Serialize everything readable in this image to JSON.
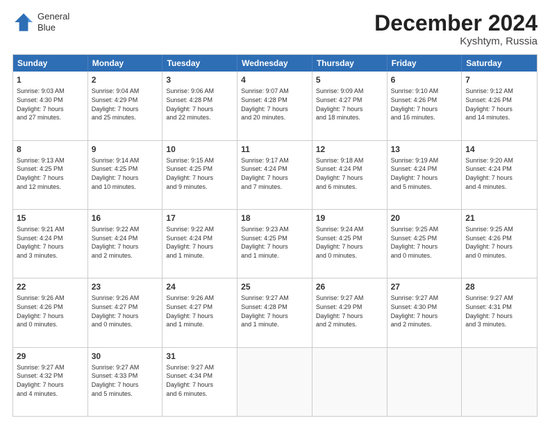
{
  "header": {
    "logo_line1": "General",
    "logo_line2": "Blue",
    "month_title": "December 2024",
    "location": "Kyshtym, Russia"
  },
  "days_of_week": [
    "Sunday",
    "Monday",
    "Tuesday",
    "Wednesday",
    "Thursday",
    "Friday",
    "Saturday"
  ],
  "weeks": [
    [
      {
        "day": "1",
        "lines": [
          "Sunrise: 9:03 AM",
          "Sunset: 4:30 PM",
          "Daylight: 7 hours",
          "and 27 minutes."
        ]
      },
      {
        "day": "2",
        "lines": [
          "Sunrise: 9:04 AM",
          "Sunset: 4:29 PM",
          "Daylight: 7 hours",
          "and 25 minutes."
        ]
      },
      {
        "day": "3",
        "lines": [
          "Sunrise: 9:06 AM",
          "Sunset: 4:28 PM",
          "Daylight: 7 hours",
          "and 22 minutes."
        ]
      },
      {
        "day": "4",
        "lines": [
          "Sunrise: 9:07 AM",
          "Sunset: 4:28 PM",
          "Daylight: 7 hours",
          "and 20 minutes."
        ]
      },
      {
        "day": "5",
        "lines": [
          "Sunrise: 9:09 AM",
          "Sunset: 4:27 PM",
          "Daylight: 7 hours",
          "and 18 minutes."
        ]
      },
      {
        "day": "6",
        "lines": [
          "Sunrise: 9:10 AM",
          "Sunset: 4:26 PM",
          "Daylight: 7 hours",
          "and 16 minutes."
        ]
      },
      {
        "day": "7",
        "lines": [
          "Sunrise: 9:12 AM",
          "Sunset: 4:26 PM",
          "Daylight: 7 hours",
          "and 14 minutes."
        ]
      }
    ],
    [
      {
        "day": "8",
        "lines": [
          "Sunrise: 9:13 AM",
          "Sunset: 4:25 PM",
          "Daylight: 7 hours",
          "and 12 minutes."
        ]
      },
      {
        "day": "9",
        "lines": [
          "Sunrise: 9:14 AM",
          "Sunset: 4:25 PM",
          "Daylight: 7 hours",
          "and 10 minutes."
        ]
      },
      {
        "day": "10",
        "lines": [
          "Sunrise: 9:15 AM",
          "Sunset: 4:25 PM",
          "Daylight: 7 hours",
          "and 9 minutes."
        ]
      },
      {
        "day": "11",
        "lines": [
          "Sunrise: 9:17 AM",
          "Sunset: 4:24 PM",
          "Daylight: 7 hours",
          "and 7 minutes."
        ]
      },
      {
        "day": "12",
        "lines": [
          "Sunrise: 9:18 AM",
          "Sunset: 4:24 PM",
          "Daylight: 7 hours",
          "and 6 minutes."
        ]
      },
      {
        "day": "13",
        "lines": [
          "Sunrise: 9:19 AM",
          "Sunset: 4:24 PM",
          "Daylight: 7 hours",
          "and 5 minutes."
        ]
      },
      {
        "day": "14",
        "lines": [
          "Sunrise: 9:20 AM",
          "Sunset: 4:24 PM",
          "Daylight: 7 hours",
          "and 4 minutes."
        ]
      }
    ],
    [
      {
        "day": "15",
        "lines": [
          "Sunrise: 9:21 AM",
          "Sunset: 4:24 PM",
          "Daylight: 7 hours",
          "and 3 minutes."
        ]
      },
      {
        "day": "16",
        "lines": [
          "Sunrise: 9:22 AM",
          "Sunset: 4:24 PM",
          "Daylight: 7 hours",
          "and 2 minutes."
        ]
      },
      {
        "day": "17",
        "lines": [
          "Sunrise: 9:22 AM",
          "Sunset: 4:24 PM",
          "Daylight: 7 hours",
          "and 1 minute."
        ]
      },
      {
        "day": "18",
        "lines": [
          "Sunrise: 9:23 AM",
          "Sunset: 4:25 PM",
          "Daylight: 7 hours",
          "and 1 minute."
        ]
      },
      {
        "day": "19",
        "lines": [
          "Sunrise: 9:24 AM",
          "Sunset: 4:25 PM",
          "Daylight: 7 hours",
          "and 0 minutes."
        ]
      },
      {
        "day": "20",
        "lines": [
          "Sunrise: 9:25 AM",
          "Sunset: 4:25 PM",
          "Daylight: 7 hours",
          "and 0 minutes."
        ]
      },
      {
        "day": "21",
        "lines": [
          "Sunrise: 9:25 AM",
          "Sunset: 4:26 PM",
          "Daylight: 7 hours",
          "and 0 minutes."
        ]
      }
    ],
    [
      {
        "day": "22",
        "lines": [
          "Sunrise: 9:26 AM",
          "Sunset: 4:26 PM",
          "Daylight: 7 hours",
          "and 0 minutes."
        ]
      },
      {
        "day": "23",
        "lines": [
          "Sunrise: 9:26 AM",
          "Sunset: 4:27 PM",
          "Daylight: 7 hours",
          "and 0 minutes."
        ]
      },
      {
        "day": "24",
        "lines": [
          "Sunrise: 9:26 AM",
          "Sunset: 4:27 PM",
          "Daylight: 7 hours",
          "and 1 minute."
        ]
      },
      {
        "day": "25",
        "lines": [
          "Sunrise: 9:27 AM",
          "Sunset: 4:28 PM",
          "Daylight: 7 hours",
          "and 1 minute."
        ]
      },
      {
        "day": "26",
        "lines": [
          "Sunrise: 9:27 AM",
          "Sunset: 4:29 PM",
          "Daylight: 7 hours",
          "and 2 minutes."
        ]
      },
      {
        "day": "27",
        "lines": [
          "Sunrise: 9:27 AM",
          "Sunset: 4:30 PM",
          "Daylight: 7 hours",
          "and 2 minutes."
        ]
      },
      {
        "day": "28",
        "lines": [
          "Sunrise: 9:27 AM",
          "Sunset: 4:31 PM",
          "Daylight: 7 hours",
          "and 3 minutes."
        ]
      }
    ],
    [
      {
        "day": "29",
        "lines": [
          "Sunrise: 9:27 AM",
          "Sunset: 4:32 PM",
          "Daylight: 7 hours",
          "and 4 minutes."
        ]
      },
      {
        "day": "30",
        "lines": [
          "Sunrise: 9:27 AM",
          "Sunset: 4:33 PM",
          "Daylight: 7 hours",
          "and 5 minutes."
        ]
      },
      {
        "day": "31",
        "lines": [
          "Sunrise: 9:27 AM",
          "Sunset: 4:34 PM",
          "Daylight: 7 hours",
          "and 6 minutes."
        ]
      },
      {
        "day": "",
        "lines": []
      },
      {
        "day": "",
        "lines": []
      },
      {
        "day": "",
        "lines": []
      },
      {
        "day": "",
        "lines": []
      }
    ]
  ]
}
